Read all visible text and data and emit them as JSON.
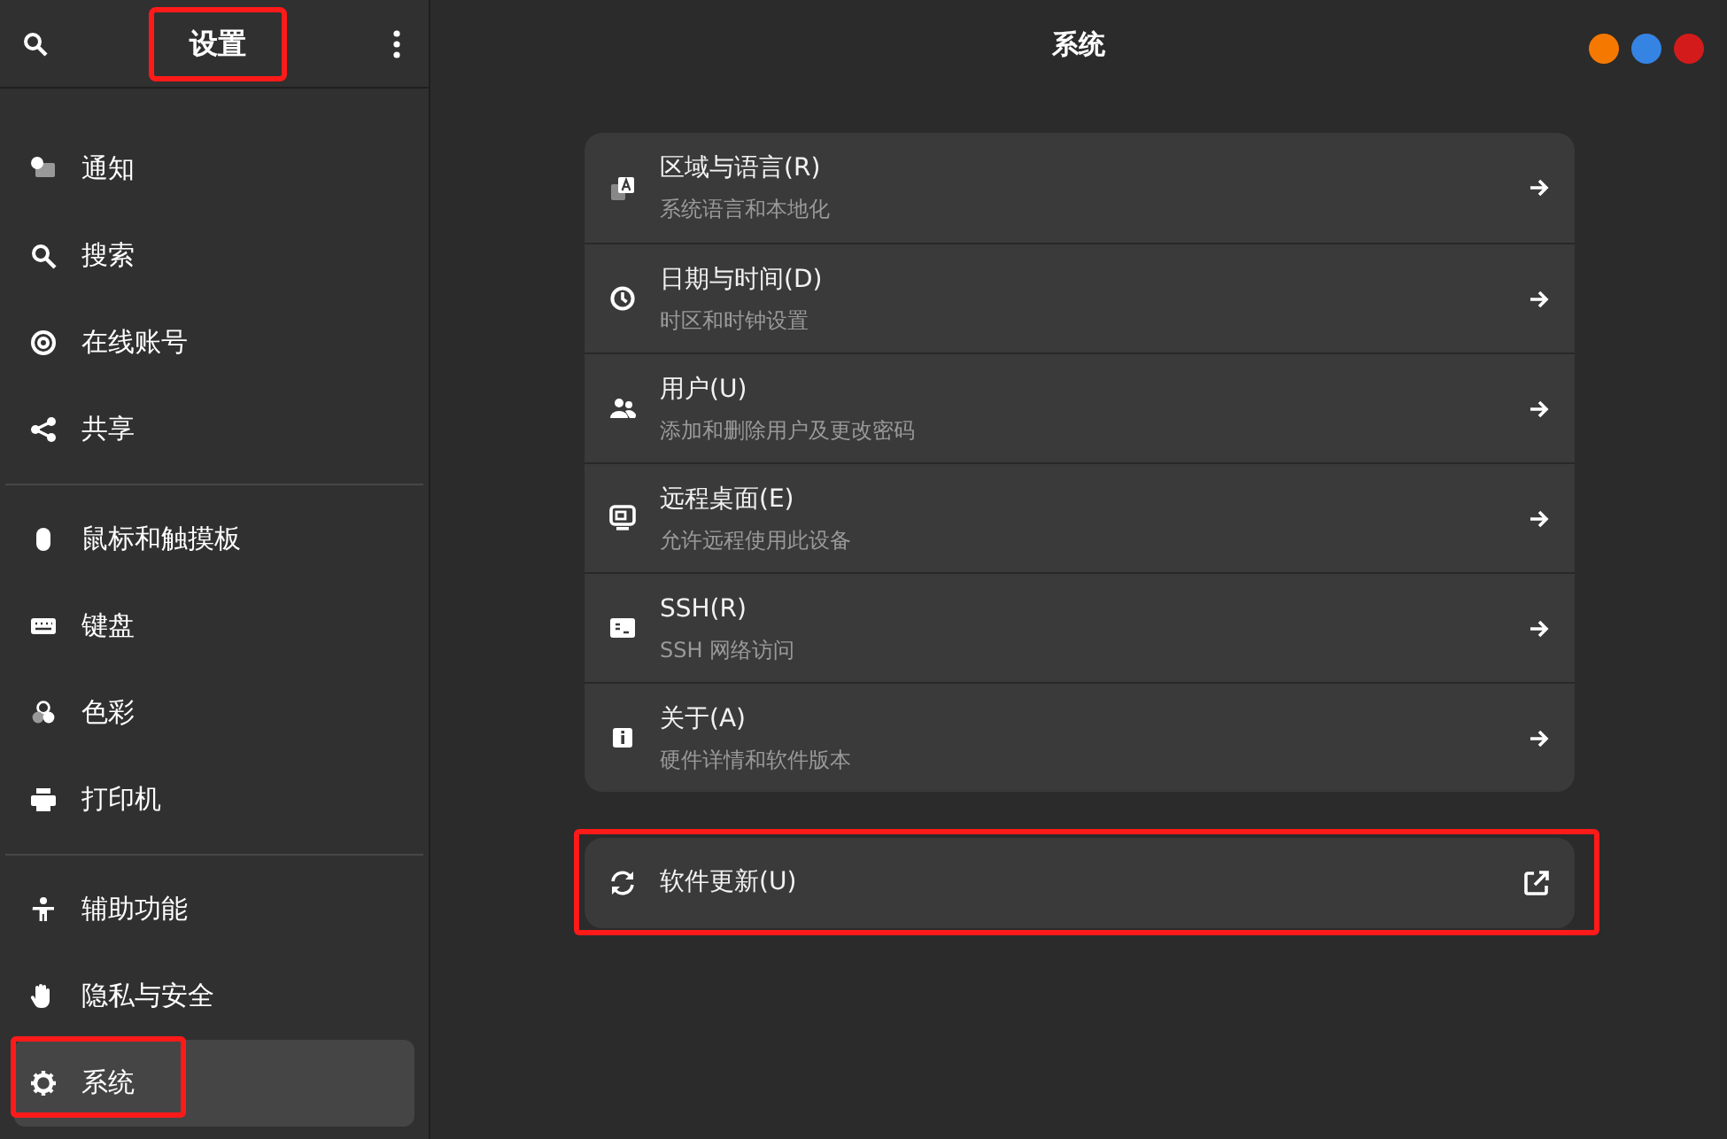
{
  "header": {
    "title": "设置",
    "title_highlighted": true
  },
  "sidebar": {
    "groups": [
      {
        "items": [
          {
            "label": "通知",
            "selected": false,
            "highlighted": false
          },
          {
            "label": "搜索",
            "selected": false,
            "highlighted": false
          },
          {
            "label": "在线账号",
            "selected": false,
            "highlighted": false
          },
          {
            "label": "共享",
            "selected": false,
            "highlighted": false
          }
        ]
      },
      {
        "items": [
          {
            "label": "鼠标和触摸板",
            "selected": false,
            "highlighted": false
          },
          {
            "label": "键盘",
            "selected": false,
            "highlighted": false
          },
          {
            "label": "色彩",
            "selected": false,
            "highlighted": false
          },
          {
            "label": "打印机",
            "selected": false,
            "highlighted": false
          }
        ]
      },
      {
        "items": [
          {
            "label": "辅助功能",
            "selected": false,
            "highlighted": false
          },
          {
            "label": "隐私与安全",
            "selected": false,
            "highlighted": false
          },
          {
            "label": "系统",
            "selected": true,
            "highlighted": true
          }
        ]
      }
    ]
  },
  "main": {
    "title": "系统",
    "window_buttons": [
      {
        "color": "#f57900"
      },
      {
        "color": "#3584e4"
      },
      {
        "color": "#d41b1b"
      }
    ],
    "cards": [
      {
        "highlighted": false,
        "rows": [
          {
            "title": "区域与语言(R)",
            "subtitle": "系统语言和本地化",
            "kind": "navigate"
          },
          {
            "title": "日期与时间(D)",
            "subtitle": "时区和时钟设置",
            "kind": "navigate"
          },
          {
            "title": "用户(U)",
            "subtitle": "添加和删除用户及更改密码",
            "kind": "navigate"
          },
          {
            "title": "远程桌面(E)",
            "subtitle": "允许远程使用此设备",
            "kind": "navigate"
          },
          {
            "title": "SSH(R)",
            "subtitle": "SSH 网络访问",
            "kind": "navigate"
          },
          {
            "title": "关于(A)",
            "subtitle": "硬件详情和软件版本",
            "kind": "navigate"
          }
        ]
      },
      {
        "highlighted": true,
        "rows": [
          {
            "title": "软件更新(U)",
            "kind": "external"
          }
        ]
      }
    ]
  }
}
